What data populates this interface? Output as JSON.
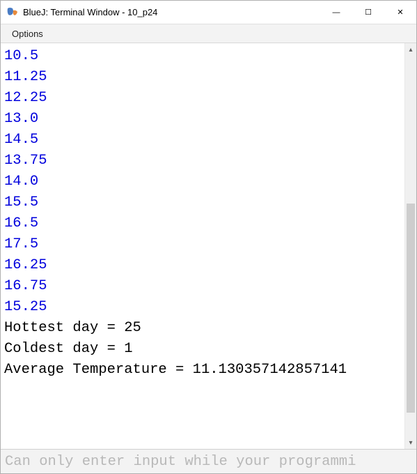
{
  "window": {
    "title": "BlueJ: Terminal Window - 10_p24",
    "controls": {
      "minimize": "—",
      "maximize": "☐",
      "close": "✕"
    }
  },
  "menubar": {
    "options": "Options"
  },
  "terminal": {
    "lines": [
      {
        "text": "10.5",
        "cls": "line-blue"
      },
      {
        "text": "11.25",
        "cls": "line-blue"
      },
      {
        "text": "12.25",
        "cls": "line-blue"
      },
      {
        "text": "13.0",
        "cls": "line-blue"
      },
      {
        "text": "14.5",
        "cls": "line-blue"
      },
      {
        "text": "13.75",
        "cls": "line-blue"
      },
      {
        "text": "14.0",
        "cls": "line-blue"
      },
      {
        "text": "15.5",
        "cls": "line-blue"
      },
      {
        "text": "16.5",
        "cls": "line-blue"
      },
      {
        "text": "17.5",
        "cls": "line-blue"
      },
      {
        "text": "16.25",
        "cls": "line-blue"
      },
      {
        "text": "16.75",
        "cls": "line-blue"
      },
      {
        "text": "15.25",
        "cls": "line-blue"
      },
      {
        "text": "Hottest day = 25",
        "cls": "line-black"
      },
      {
        "text": "Coldest day = 1",
        "cls": "line-black"
      },
      {
        "text": "Average Temperature = 11.130357142857141",
        "cls": "line-black"
      }
    ]
  },
  "statusbar": {
    "text": "Can only enter input while your programmi"
  },
  "scrollbar": {
    "up": "▴",
    "down": "▾"
  }
}
